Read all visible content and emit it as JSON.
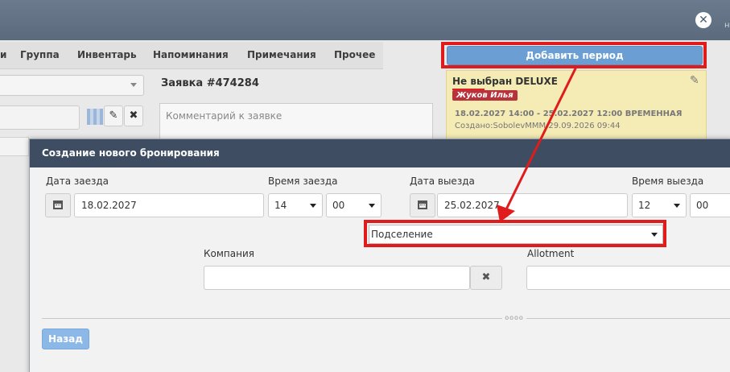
{
  "window": {
    "close_glyph": "✕",
    "edge_text": "но"
  },
  "tabs": [
    {
      "label": "и"
    },
    {
      "label": "Группа"
    },
    {
      "label": "Инвентарь"
    },
    {
      "label": "Напоминания"
    },
    {
      "label": "Примечания"
    },
    {
      "label": "Прочее"
    }
  ],
  "order": {
    "title": "Заявка #474284",
    "comment_placeholder": "Комментарий к заявке",
    "edit_glyph": "✎",
    "remove_glyph": "✖"
  },
  "period": {
    "add_button": "Добавить период",
    "card_title": "Не выбран DELUXE",
    "guest": "Жуков Илья",
    "dates": "18.02.2027 14:00 - 25.02.2027 12:00 ВРЕМЕННАЯ",
    "created": "Создано:SobolevMMM 29.09.2026 09:44",
    "edit_icon": "pencil-icon"
  },
  "modal": {
    "title": "Создание нового бронирования",
    "checkin_date_label": "Дата заезда",
    "checkin_date_value": "18.02.2027",
    "checkin_time_label": "Время заезда",
    "checkin_hour": "14",
    "checkin_minute": "00",
    "checkout_date_label": "Дата выезда",
    "checkout_date_value": "25.02.2027",
    "checkout_time_label": "Время выезда",
    "checkout_hour": "12",
    "checkout_minute": "00",
    "type_select": "Подселение",
    "company_label": "Компания",
    "company_value": "",
    "clear_glyph": "✖",
    "allotment_label": "Allotment",
    "grip": "oooo",
    "back_button": "Назад"
  },
  "colors": {
    "highlight": "#e01b1b",
    "header": "#3e4d61",
    "primary_button": "#6b9fd4",
    "card_bg": "#f5ebb5",
    "badge": "#b8323c"
  }
}
